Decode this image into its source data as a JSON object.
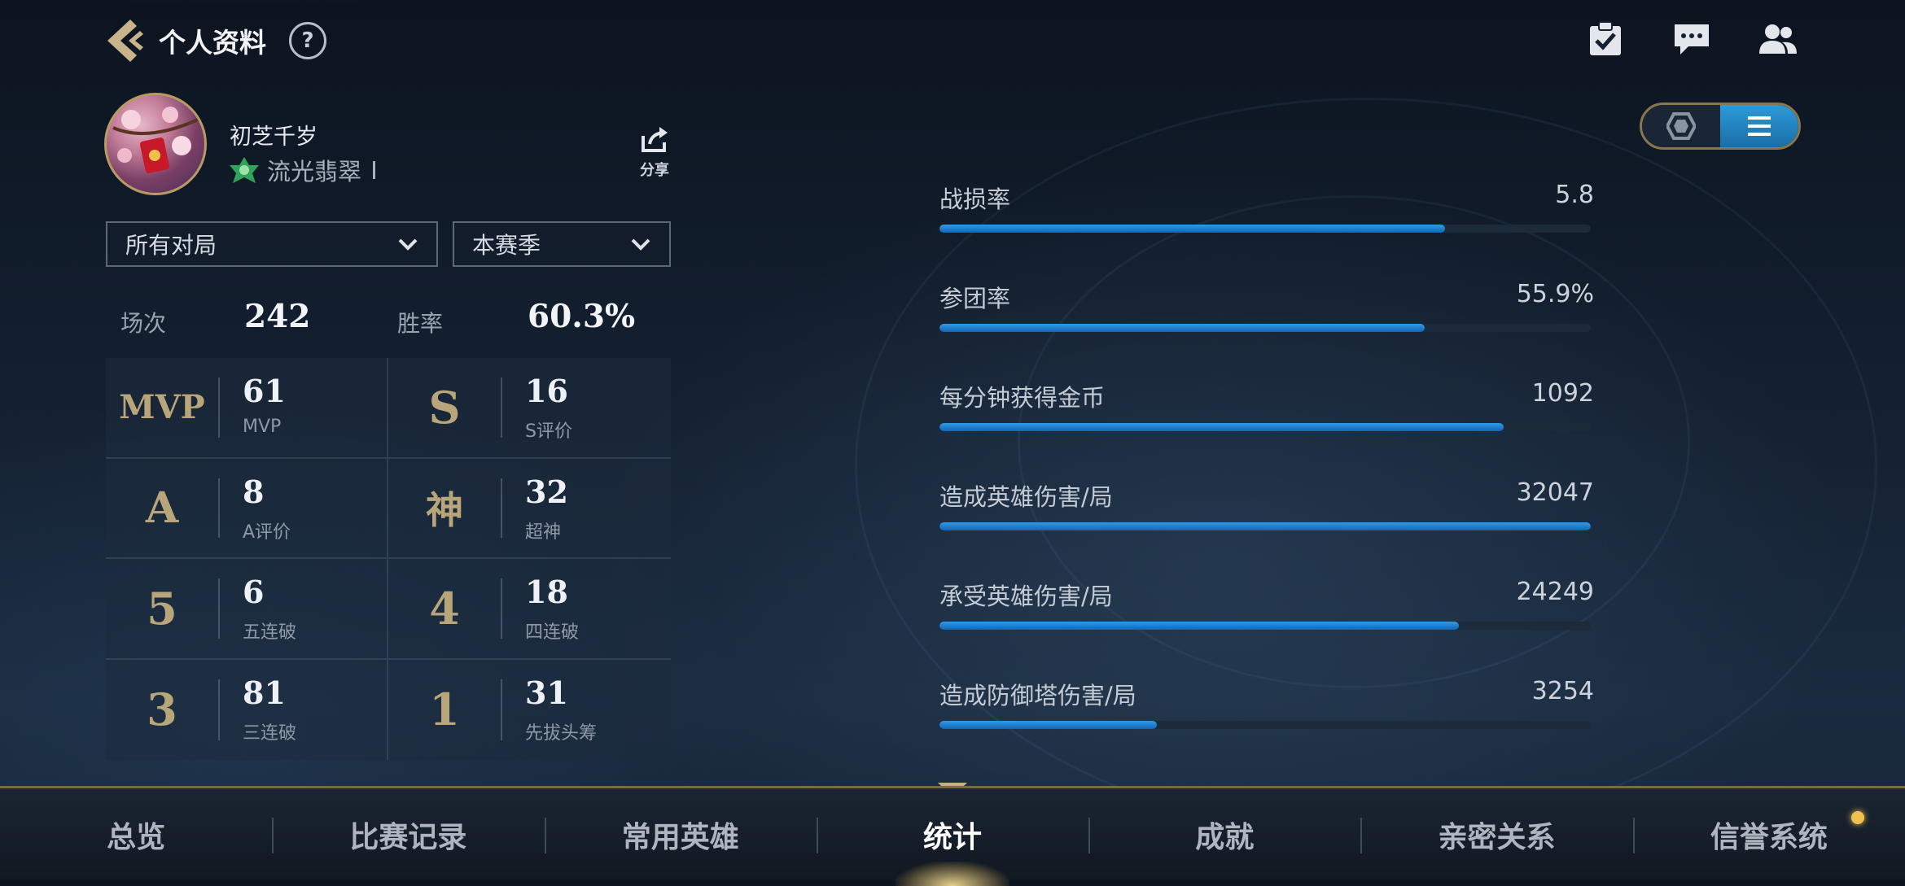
{
  "header": {
    "title": "个人资料",
    "help": "?"
  },
  "profile": {
    "name": "初芝千岁",
    "rank": "流光翡翠",
    "share_label": "分享"
  },
  "filters": {
    "mode": "所有对局",
    "season": "本赛季"
  },
  "summary": {
    "matches_label": "场次",
    "matches_value": "242",
    "winrate_label": "胜率",
    "winrate_value": "60.3%"
  },
  "stats": [
    {
      "badge": "MVP",
      "value": "61",
      "label": "MVP"
    },
    {
      "badge": "S",
      "value": "16",
      "label": "S评价"
    },
    {
      "badge": "A",
      "value": "8",
      "label": "A评价"
    },
    {
      "badge": "神",
      "value": "32",
      "label": "超神"
    },
    {
      "badge": "5",
      "value": "6",
      "label": "五连破"
    },
    {
      "badge": "4",
      "value": "18",
      "label": "四连破"
    },
    {
      "badge": "3",
      "value": "81",
      "label": "三连破"
    },
    {
      "badge": "1",
      "value": "31",
      "label": "先拔头筹"
    }
  ],
  "metrics": [
    {
      "label": "战损率",
      "value": "5.8",
      "fill": 0.776
    },
    {
      "label": "参团率",
      "value": "55.9%",
      "fill": 0.745
    },
    {
      "label": "每分钟获得金币",
      "value": "1092",
      "fill": 0.866
    },
    {
      "label": "造成英雄伤害/局",
      "value": "32047",
      "fill": 1.0
    },
    {
      "label": "承受英雄伤害/局",
      "value": "24249",
      "fill": 0.798
    },
    {
      "label": "造成防御塔伤害/局",
      "value": "3254",
      "fill": 0.334
    }
  ],
  "nav": [
    "总览",
    "比赛记录",
    "常用英雄",
    "统计",
    "成就",
    "亲密关系",
    "信誉系统"
  ],
  "active_tab": "统计",
  "colors": {
    "accent": "#1f7fd0",
    "gold": "#b9a57a"
  }
}
